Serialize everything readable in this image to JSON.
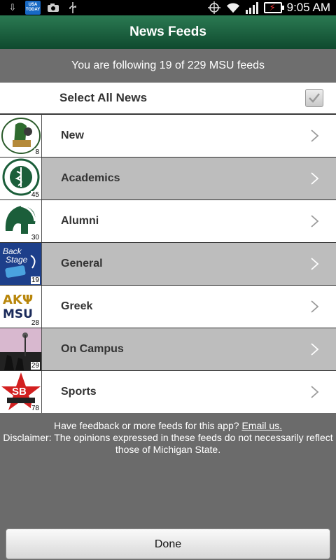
{
  "status_bar": {
    "left_icons": [
      "download-icon",
      "usa-today-icon",
      "camera-icon",
      "usb-icon"
    ],
    "usa_today_text": "USA TODAY",
    "right_icons": [
      "gps-icon",
      "wifi-icon",
      "signal-icon",
      "battery-charging-icon"
    ],
    "time": "9:05 AM"
  },
  "header": {
    "title": "News Feeds"
  },
  "summary": {
    "text": "You are following 19 of 229 MSU feeds"
  },
  "select_all": {
    "label": "Select All News",
    "checked": true
  },
  "feeds": [
    {
      "label": "New",
      "count": "8",
      "style": "white",
      "thumb_text": "",
      "thumb_icon": "alumni-club-logo-icon"
    },
    {
      "label": "Academics",
      "count": "45",
      "style": "gray",
      "thumb_text": "",
      "thumb_icon": "vet-medicine-seal-icon"
    },
    {
      "label": "Alumni",
      "count": "30",
      "style": "white",
      "thumb_text": "",
      "thumb_icon": "spartan-helmet-icon"
    },
    {
      "label": "General",
      "count": "19",
      "style": "gray",
      "thumb_text": "Back Stage",
      "thumb_icon": "backstage-pass-icon"
    },
    {
      "label": "Greek",
      "count": "28",
      "style": "white",
      "thumb_text": "AKΨ MSU",
      "thumb_icon": "greek-letters-icon"
    },
    {
      "label": "On Campus",
      "count": "29",
      "style": "gray",
      "thumb_text": "",
      "thumb_icon": "campus-photo-icon"
    },
    {
      "label": "Sports",
      "count": "78",
      "style": "white",
      "thumb_text": "SB NATION",
      "thumb_icon": "sbnation-star-icon"
    }
  ],
  "footer": {
    "feedback_text": "Have feedback or more feeds for this app?",
    "email_link": "Email us.",
    "disclaimer": "Disclaimer: The opinions expressed in these feeds do not necessarily reflect those of Michigan State."
  },
  "done_button": {
    "label": "Done"
  },
  "colors": {
    "header_green": "#1f6b45",
    "row_gray": "#bdbdbd",
    "background": "#6b6b6b"
  }
}
